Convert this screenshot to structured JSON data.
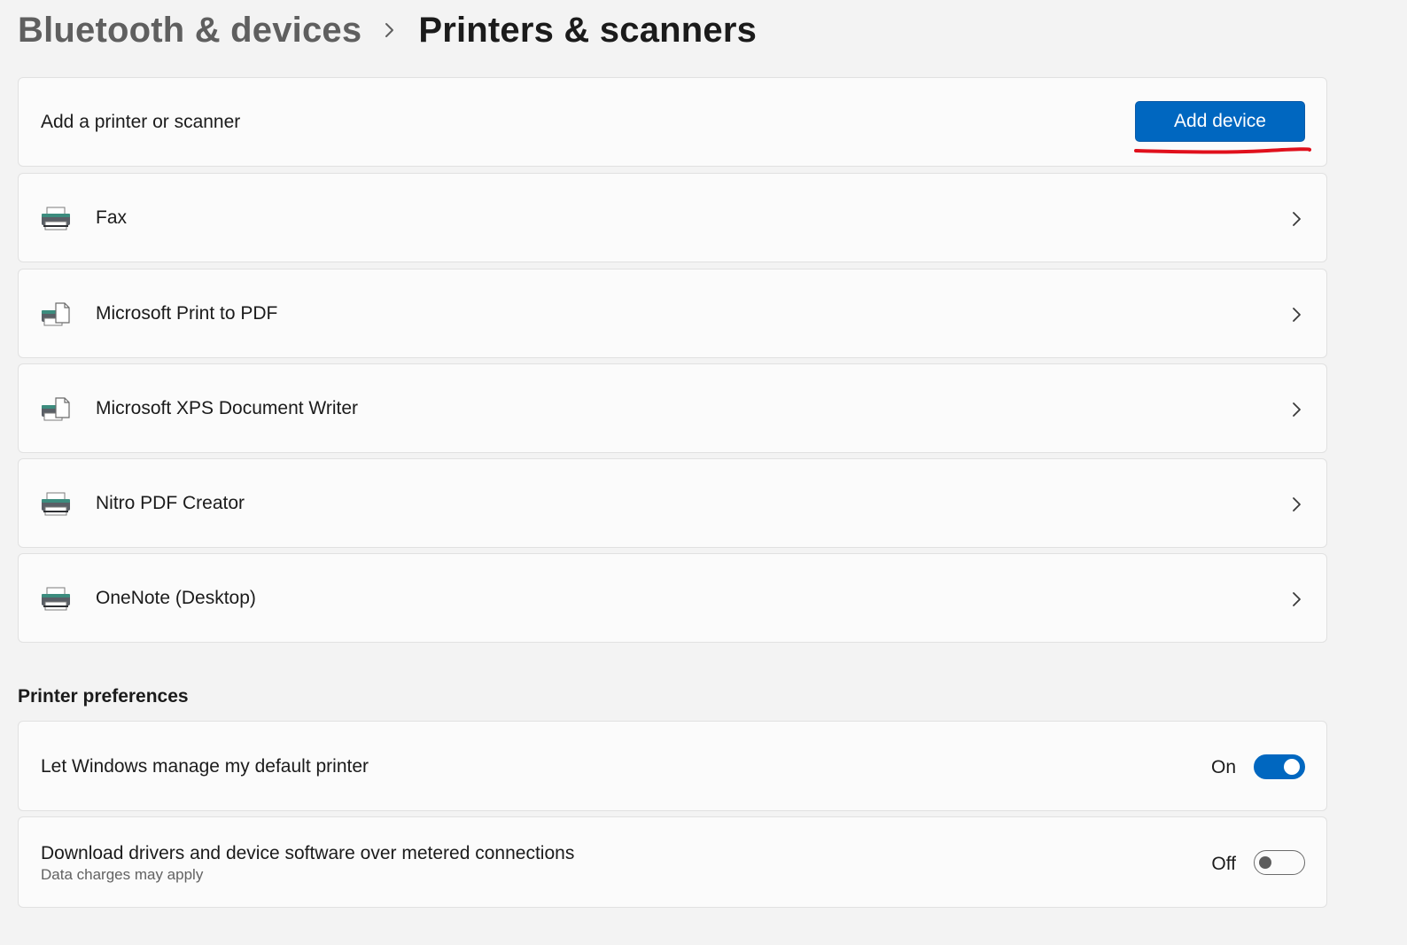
{
  "breadcrumb": {
    "parent": "Bluetooth & devices",
    "current": "Printers & scanners"
  },
  "add_printer": {
    "label": "Add a printer or scanner",
    "button_label": "Add device"
  },
  "devices": [
    {
      "name": "Fax",
      "icon": "printer-icon"
    },
    {
      "name": "Microsoft Print to PDF",
      "icon": "printer-document-icon"
    },
    {
      "name": "Microsoft XPS Document Writer",
      "icon": "printer-document-icon"
    },
    {
      "name": "Nitro PDF Creator",
      "icon": "printer-icon"
    },
    {
      "name": "OneNote (Desktop)",
      "icon": "printer-icon"
    }
  ],
  "preferences": {
    "title": "Printer preferences",
    "items": [
      {
        "label": "Let Windows manage my default printer",
        "state_text": "On",
        "enabled": true
      },
      {
        "label": "Download drivers and device software over metered connections",
        "description": "Data charges may apply",
        "state_text": "Off",
        "enabled": false
      }
    ]
  },
  "colors": {
    "accent": "#0067c0",
    "annotation": "#e0101c",
    "background": "#f3f3f3",
    "card": "#fbfbfb"
  }
}
